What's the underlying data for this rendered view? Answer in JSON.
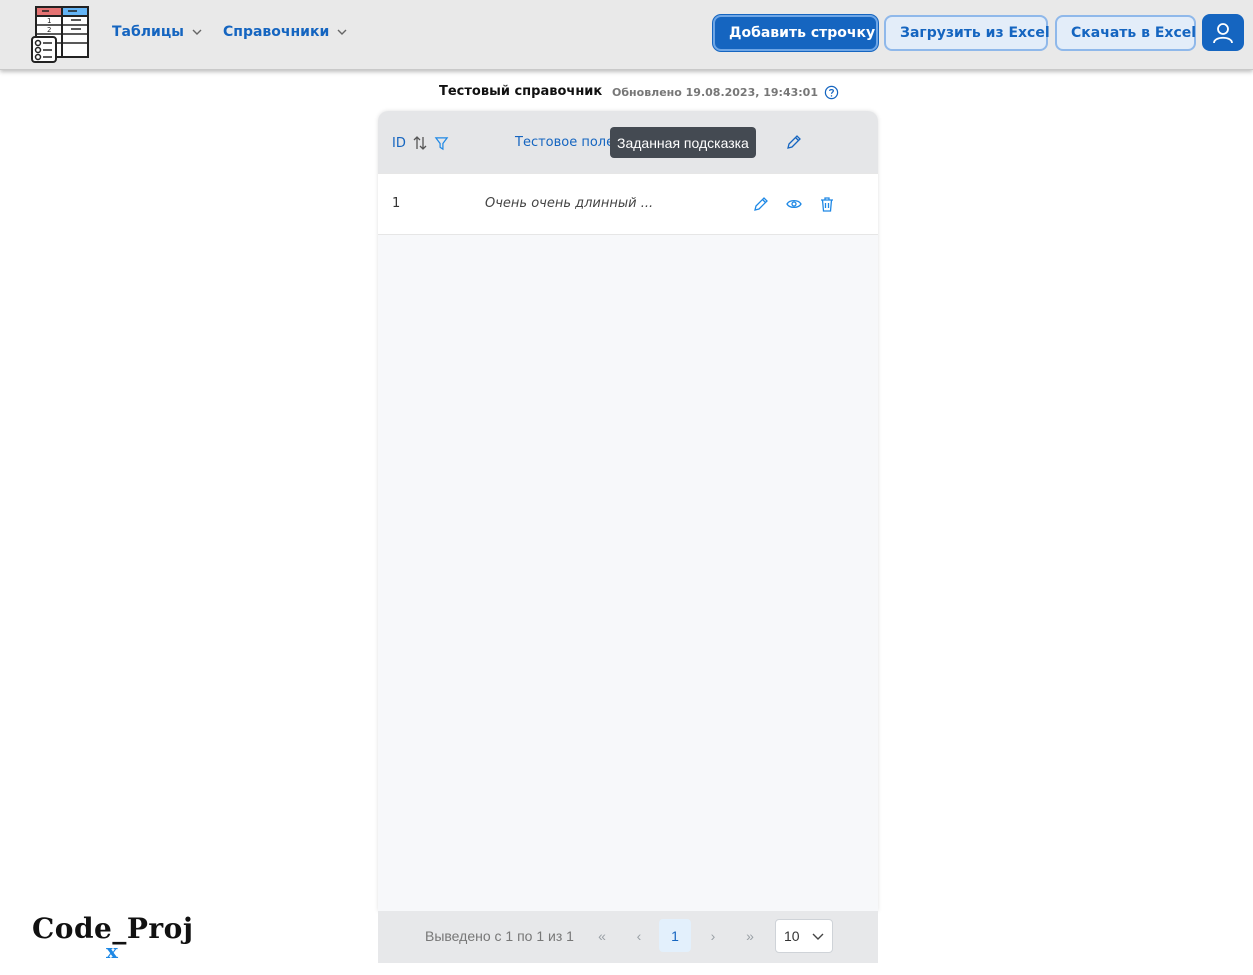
{
  "nav": {
    "tables_label": "Таблицы",
    "directories_label": "Справочники"
  },
  "actions": {
    "add_row": "Добавить строчку",
    "upload_excel": "Загрузить из Excel",
    "download_excel": "Скачать в Excel"
  },
  "page": {
    "title": "Тестовый справочник",
    "updated": "Обновлено 19.08.2023, 19:43:01"
  },
  "table": {
    "columns": [
      {
        "label": "ID"
      },
      {
        "label": "Тестовое поле",
        "required_mark": "*"
      }
    ],
    "rows": [
      {
        "id": "1",
        "value": "Очень очень длинный ..."
      }
    ]
  },
  "tooltip": "Заданная подсказка",
  "pagination": {
    "info": "Выведено с 1 по 1 из 1",
    "first": "«",
    "prev": "‹",
    "current_page": "1",
    "next": "›",
    "last": "»",
    "page_size": "10"
  },
  "watermark": {
    "text": "Code_Proj",
    "accent": "x"
  },
  "colors": {
    "accent": "#1565c0",
    "required": "#d32f2f",
    "tooltip_bg": "#444a52"
  }
}
